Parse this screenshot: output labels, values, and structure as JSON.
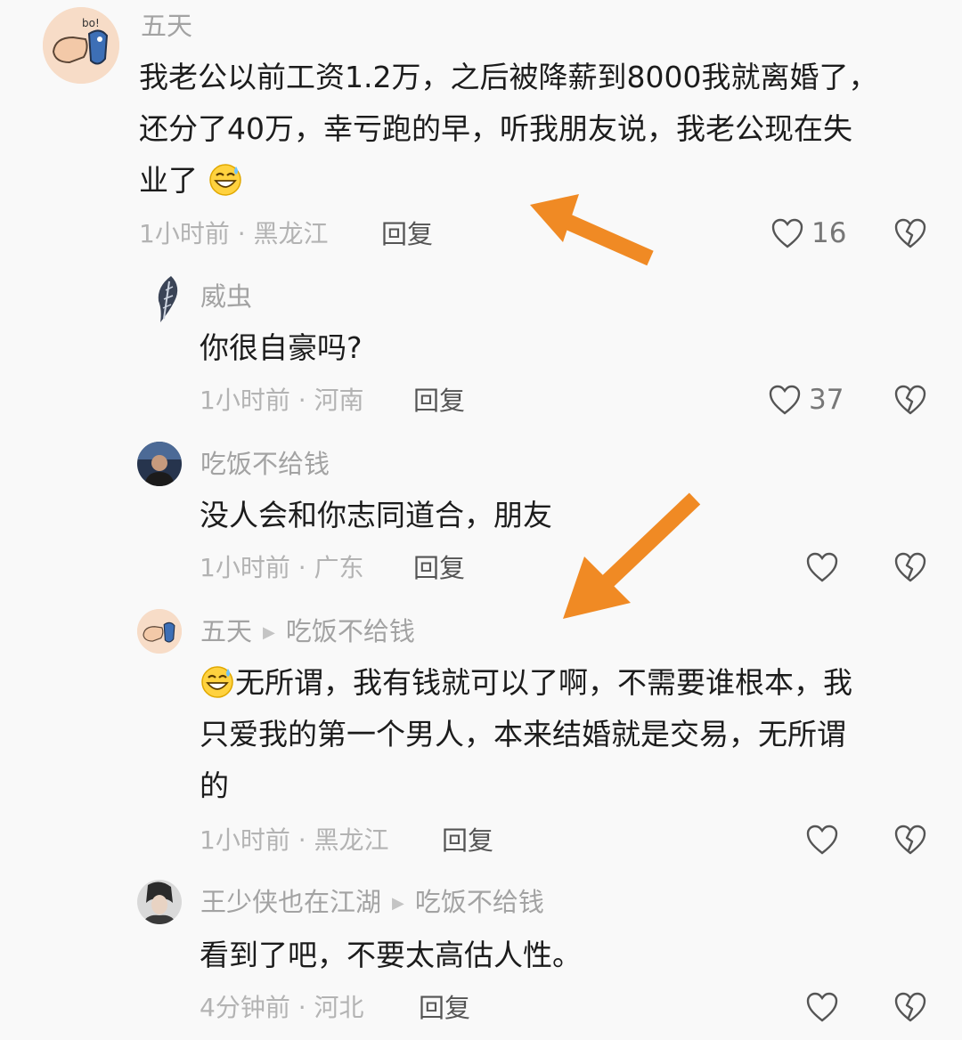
{
  "comments": [
    {
      "user": "五天",
      "text_lines": [
        "我老公以前工资1.2万，之后被降薪到8000我就离婚了，",
        "还分了40万，幸亏跑的早，听我朋友说，我老公现在失",
        "业了"
      ],
      "time": "1小时前",
      "location": "黑龙江",
      "reply_label": "回复",
      "likes": "16",
      "avatar_icon": "fist-cartoon-avatar"
    },
    {
      "user": "威虫",
      "text_lines": [
        "你很自豪吗?"
      ],
      "time": "1小时前",
      "location": "河南",
      "reply_label": "回复",
      "likes": "37",
      "avatar_icon": "feather-avatar"
    },
    {
      "user": "吃饭不给钱",
      "text_lines": [
        "没人会和你志同道合，朋友"
      ],
      "time": "1小时前",
      "location": "广东",
      "reply_label": "回复",
      "likes": "",
      "avatar_icon": "person-photo-avatar"
    },
    {
      "user": "五天",
      "reply_to": "吃饭不给钱",
      "text_lines": [
        "无所谓，我有钱就可以了啊，不需要谁根本，我",
        "只爱我的第一个男人，本来结婚就是交易，无所谓",
        "的"
      ],
      "time": "1小时前",
      "location": "黑龙江",
      "reply_label": "回复",
      "likes": "",
      "avatar_icon": "fist-cartoon-avatar"
    },
    {
      "user": "王少侠也在江湖",
      "reply_to": "吃饭不给钱",
      "text_lines": [
        "看到了吧，不要太高估人性。"
      ],
      "time": "4分钟前",
      "location": "河北",
      "reply_label": "回复",
      "likes": "",
      "avatar_icon": "person-photo-avatar"
    }
  ],
  "separator": " · ",
  "annotation_color": "#f08a24"
}
